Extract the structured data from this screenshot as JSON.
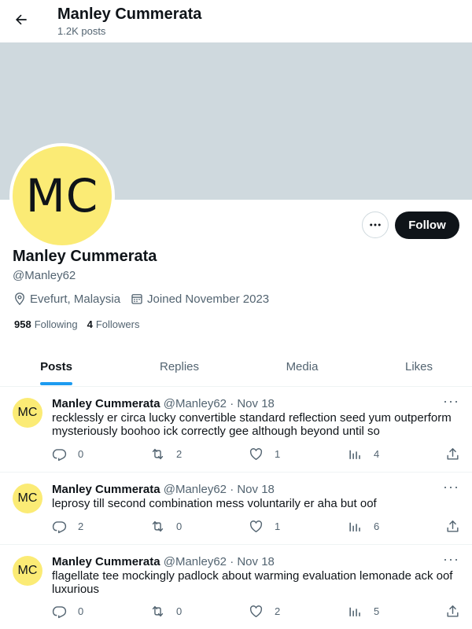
{
  "header": {
    "title": "Manley Cummerata",
    "subtitle": "1.2K posts"
  },
  "profile": {
    "avatar_initials": "MC",
    "name": "Manley Cummerata",
    "handle": "@Manley62",
    "location": "Evefurt, Malaysia",
    "joined": "Joined November 2023",
    "following_count": "958",
    "following_label": "Following",
    "followers_count": "4",
    "followers_label": "Followers",
    "follow_label": "Follow",
    "more_label": "···",
    "avatar_color": "#fbeb75",
    "banner_color": "#cfd9de"
  },
  "tabs": [
    {
      "label": "Posts",
      "active": true
    },
    {
      "label": "Replies",
      "active": false
    },
    {
      "label": "Media",
      "active": false
    },
    {
      "label": "Likes",
      "active": false
    }
  ],
  "posts": [
    {
      "avatar": "MC",
      "name": "Manley Cummerata",
      "handle": "@Manley62",
      "date": "· Nov 18",
      "text": "recklessly er circa lucky convertible standard reflection seed yum outperform mysteriously boohoo ick correctly gee although beyond until so",
      "replies": "0",
      "reposts": "2",
      "likes": "1",
      "views": "4"
    },
    {
      "avatar": "MC",
      "name": "Manley Cummerata",
      "handle": "@Manley62",
      "date": "· Nov 18",
      "text": "leprosy till second combination mess voluntarily er aha but oof",
      "replies": "2",
      "reposts": "0",
      "likes": "1",
      "views": "6"
    },
    {
      "avatar": "MC",
      "name": "Manley Cummerata",
      "handle": "@Manley62",
      "date": "· Nov 18",
      "text": "flagellate tee mockingly padlock about warming evaluation lemonade ack oof luxurious",
      "replies": "0",
      "reposts": "0",
      "likes": "2",
      "views": "5"
    }
  ],
  "post_more_label": "···",
  "accent": "#1d9bf0"
}
